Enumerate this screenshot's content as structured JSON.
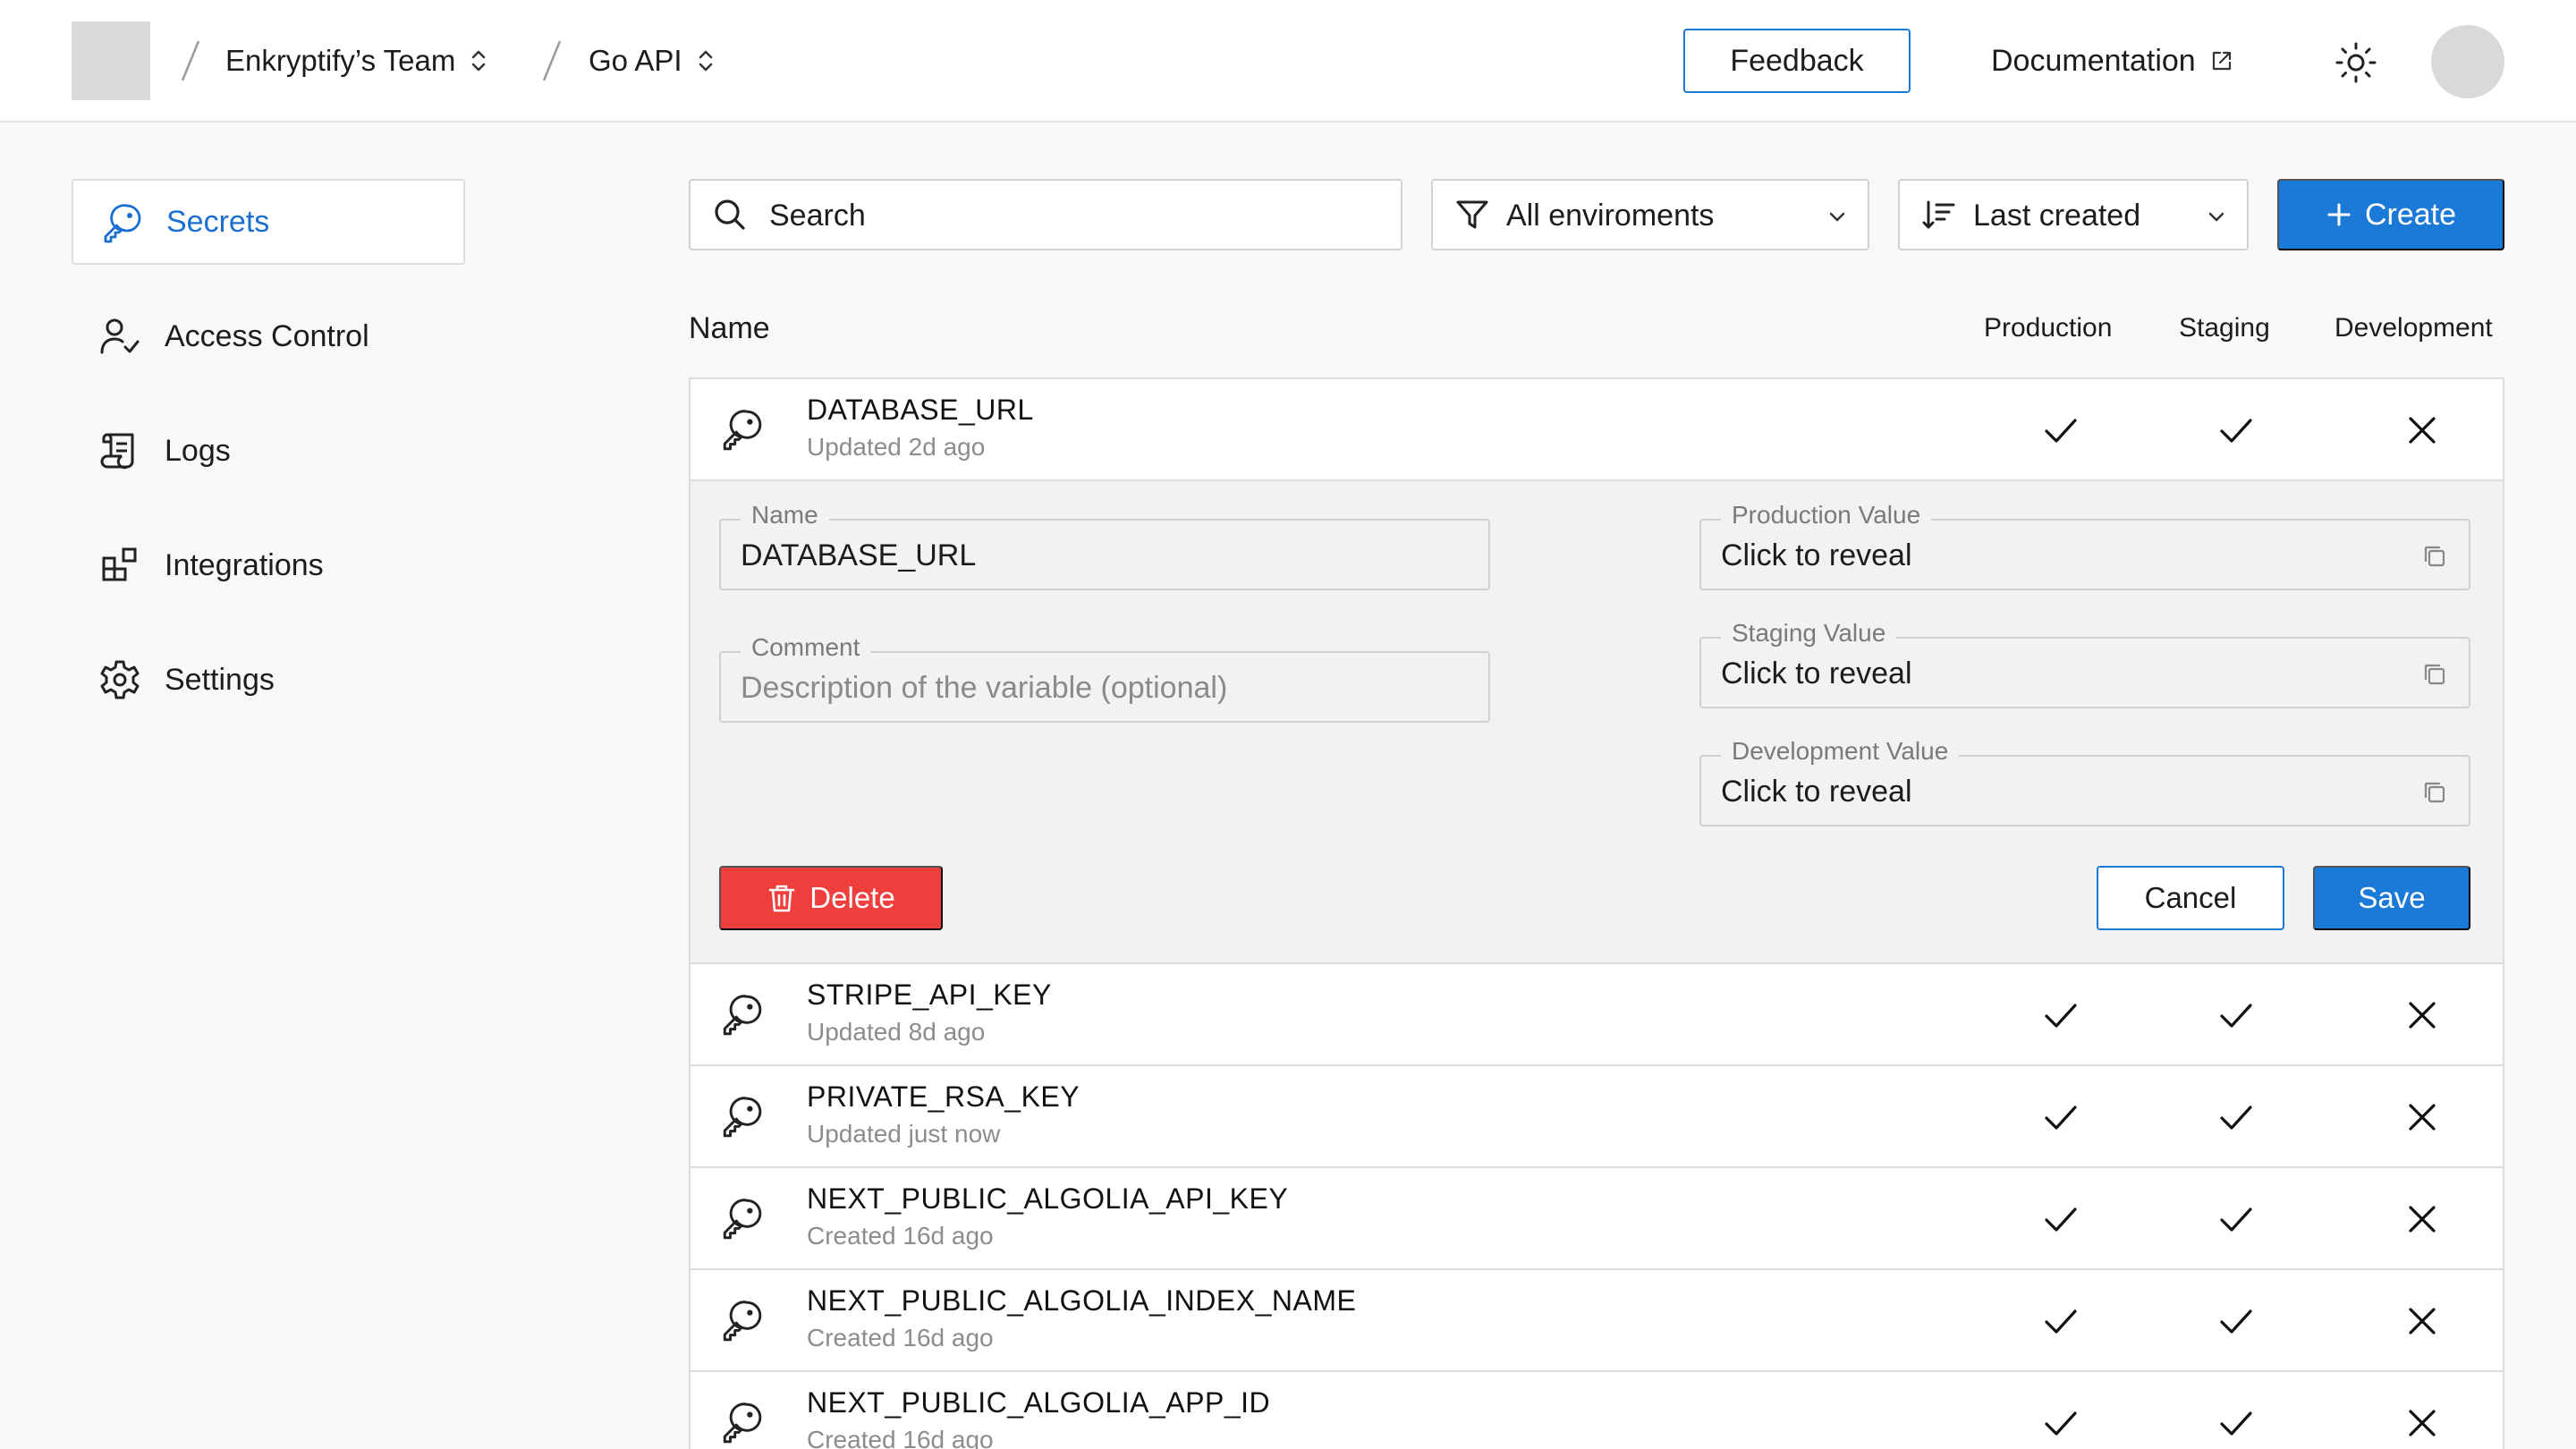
{
  "header": {
    "team": "Enkryptify’s Team",
    "project": "Go API",
    "feedback_label": "Feedback",
    "docs_label": "Documentation"
  },
  "sidebar": {
    "items": [
      {
        "label": "Secrets",
        "icon": "key-icon",
        "active": true
      },
      {
        "label": "Access Control",
        "icon": "user-check-icon",
        "active": false
      },
      {
        "label": "Logs",
        "icon": "scroll-icon",
        "active": false
      },
      {
        "label": "Integrations",
        "icon": "blocks-icon",
        "active": false
      },
      {
        "label": "Settings",
        "icon": "gear-icon",
        "active": false
      }
    ]
  },
  "toolbar": {
    "search_placeholder": "Search",
    "env_filter": "All enviroments",
    "sort": "Last created",
    "create_label": "Create"
  },
  "table": {
    "headers": {
      "name": "Name",
      "production": "Production",
      "staging": "Staging",
      "development": "Development"
    },
    "rows": [
      {
        "name": "DATABASE_URL",
        "updated": "Updated 2d ago",
        "production": true,
        "staging": true,
        "development": false
      },
      {
        "name": "STRIPE_API_KEY",
        "updated": "Updated 8d ago",
        "production": true,
        "staging": true,
        "development": false
      },
      {
        "name": "PRIVATE_RSA_KEY",
        "updated": "Updated just now",
        "production": true,
        "staging": true,
        "development": false
      },
      {
        "name": "NEXT_PUBLIC_ALGOLIA_API_KEY",
        "updated": "Created 16d ago",
        "production": true,
        "staging": true,
        "development": false
      },
      {
        "name": "NEXT_PUBLIC_ALGOLIA_INDEX_NAME",
        "updated": "Created 16d ago",
        "production": true,
        "staging": true,
        "development": false
      },
      {
        "name": "NEXT_PUBLIC_ALGOLIA_APP_ID",
        "updated": "Created 16d ago",
        "production": true,
        "staging": true,
        "development": false
      }
    ]
  },
  "editor": {
    "name_label": "Name",
    "name_value": "DATABASE_URL",
    "comment_label": "Comment",
    "comment_placeholder": "Description of the variable (optional)",
    "production_label": "Production Value",
    "production_value": "Click to reveal",
    "staging_label": "Staging Value",
    "staging_value": "Click to reveal",
    "development_label": "Development Value",
    "development_value": "Click to reveal",
    "delete_label": "Delete",
    "cancel_label": "Cancel",
    "save_label": "Save"
  },
  "colors": {
    "accent": "#1b7ad8",
    "danger": "#ee3f3c",
    "placeholder": "#d9d9d9"
  }
}
